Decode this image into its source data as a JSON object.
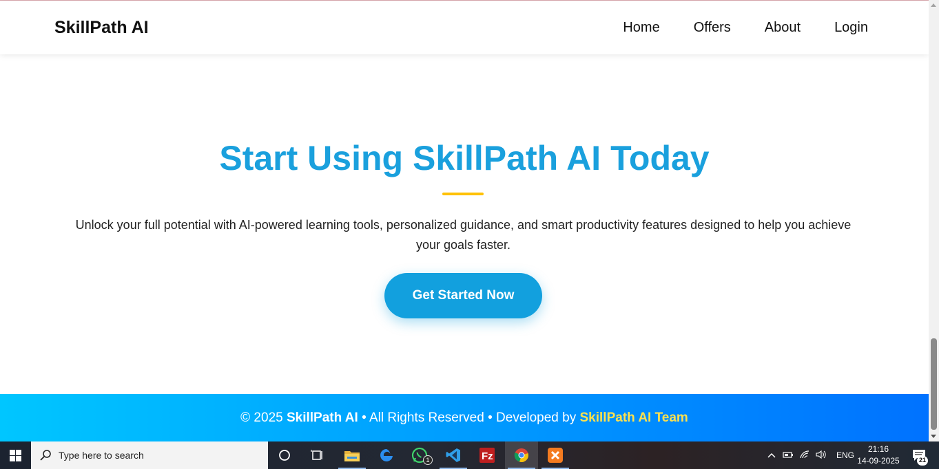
{
  "navbar": {
    "brand": "SkillPath AI",
    "links": [
      "Home",
      "Offers",
      "About",
      "Login"
    ]
  },
  "hero": {
    "title": "Start Using SkillPath AI Today",
    "description": "Unlock your full potential with AI-powered learning tools, personalized guidance, and smart productivity features designed to help you achieve your goals faster.",
    "cta_label": "Get Started Now"
  },
  "footer": {
    "prefix": "© 2025 ",
    "brand": "SkillPath AI",
    "middle": " • All Rights Reserved • Developed by ",
    "team": "SkillPath AI Team"
  },
  "taskbar": {
    "search_placeholder": "Type here to search",
    "apps": [
      "cortana-icon",
      "task-view-icon",
      "file-explorer-icon",
      "edge-icon",
      "whatsapp-icon",
      "vscode-icon",
      "filezilla-icon",
      "chrome-icon",
      "xampp-icon"
    ],
    "whatsapp_badge": "1",
    "language": "ENG",
    "time": "21:16",
    "date": "14-09-2025",
    "notification_count": "21"
  },
  "colors": {
    "accent": "#1aa0dd",
    "divider": "#ffc107",
    "footer_gradient_start": "#00c6ff",
    "footer_gradient_end": "#0072ff",
    "footer_team": "#ffe14d"
  }
}
